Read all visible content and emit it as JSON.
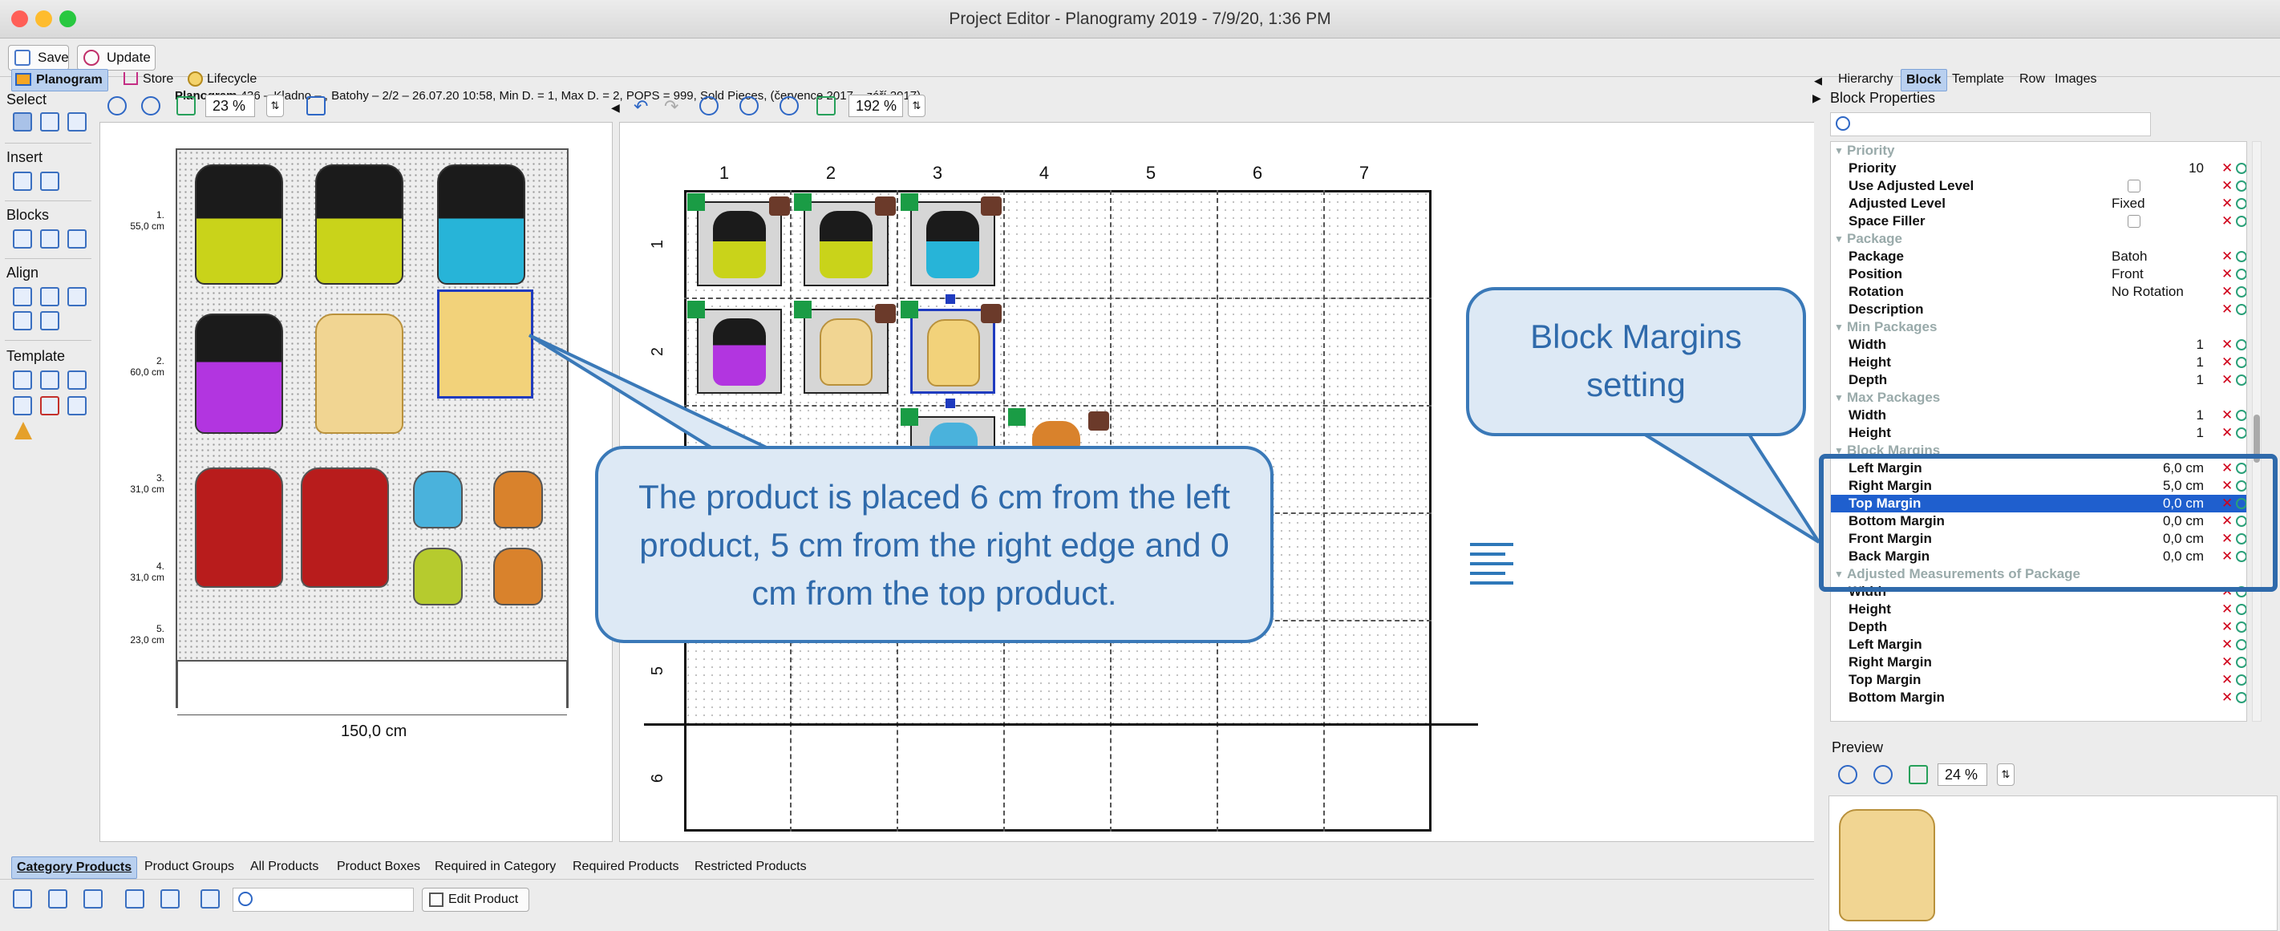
{
  "window": {
    "title": "Project Editor - Planogramy 2019 - 7/9/20, 1:36 PM"
  },
  "toolbar": {
    "save_label": "Save",
    "update_label": "Update",
    "info_bold": "Planogram",
    "info_text": " 436 – Kladno – , Batohy – 2/2 – 26.07.20 10:58, Min D. = 1, Max D. = 2, POPS = 999, Sold Pieces, (července 2017 – září 2017)"
  },
  "left_tabs": [
    "Planogram",
    "Store",
    "Lifecycle"
  ],
  "tool_groups": {
    "select": "Select",
    "insert": "Insert",
    "blocks": "Blocks",
    "align": "Align",
    "template": "Template"
  },
  "left_view": {
    "zoom": "23 %",
    "shelf_labels": [
      {
        "num": "1.",
        "size": "55,0 cm"
      },
      {
        "num": "2.",
        "size": "60,0 cm"
      },
      {
        "num": "3.",
        "size": "31,0 cm"
      },
      {
        "num": "4.",
        "size": "31,0 cm"
      },
      {
        "num": "5.",
        "size": "23,0 cm"
      }
    ],
    "width_label": "150,0 cm"
  },
  "center_view": {
    "zoom": "192 %",
    "columns": [
      "1",
      "2",
      "3",
      "4",
      "5",
      "6",
      "7"
    ],
    "rows": [
      "1",
      "2",
      "5",
      "6"
    ]
  },
  "right_tabs": [
    "Hierarchy",
    "Block",
    "Template",
    "Row",
    "Images"
  ],
  "block_properties": {
    "title": "Block Properties",
    "sections": [
      {
        "name": "Priority",
        "rows": [
          {
            "k": "Priority",
            "v": "10",
            "align": "right"
          },
          {
            "k": "Use Adjusted Level",
            "v": "",
            "check": true
          },
          {
            "k": "Adjusted Level",
            "v": "Fixed"
          },
          {
            "k": "Space Filler",
            "v": "",
            "check": true
          }
        ]
      },
      {
        "name": "Package",
        "rows": [
          {
            "k": "Package",
            "v": "Batoh"
          },
          {
            "k": "Position",
            "v": "Front"
          },
          {
            "k": "Rotation",
            "v": "No Rotation"
          },
          {
            "k": "Description",
            "v": ""
          }
        ]
      },
      {
        "name": "Min Packages",
        "rows": [
          {
            "k": "Width",
            "v": "1",
            "align": "right"
          },
          {
            "k": "Height",
            "v": "1",
            "align": "right"
          },
          {
            "k": "Depth",
            "v": "1",
            "align": "right"
          }
        ]
      },
      {
        "name": "Max Packages",
        "rows": [
          {
            "k": "Width",
            "v": "1",
            "align": "right"
          },
          {
            "k": "Height",
            "v": "1",
            "align": "right"
          }
        ]
      },
      {
        "name": "Block Margins",
        "rows": [
          {
            "k": "Left Margin",
            "v": "6,0 cm",
            "align": "right"
          },
          {
            "k": "Right Margin",
            "v": "5,0 cm",
            "align": "right"
          },
          {
            "k": "Top Margin",
            "v": "0,0 cm",
            "align": "right",
            "selected": true
          },
          {
            "k": "Bottom Margin",
            "v": "0,0 cm",
            "align": "right"
          },
          {
            "k": "Front Margin",
            "v": "0,0 cm",
            "align": "right"
          },
          {
            "k": "Back Margin",
            "v": "0,0 cm",
            "align": "right"
          }
        ]
      },
      {
        "name": "Adjusted Measurements of Package",
        "rows": [
          {
            "k": "Width",
            "v": ""
          },
          {
            "k": "Height",
            "v": ""
          },
          {
            "k": "Depth",
            "v": ""
          },
          {
            "k": "Left Margin",
            "v": ""
          },
          {
            "k": "Right Margin",
            "v": ""
          },
          {
            "k": "Top Margin",
            "v": ""
          },
          {
            "k": "Bottom Margin",
            "v": ""
          }
        ]
      }
    ]
  },
  "preview": {
    "title": "Preview",
    "zoom": "24 %"
  },
  "bottom_tabs": [
    "Category Products",
    "Product Groups",
    "All Products",
    "Product Boxes",
    "Required in Category",
    "Required Products",
    "Restricted Products"
  ],
  "bottom_toolbar": {
    "edit_product": "Edit Product"
  },
  "callouts": {
    "margins_title": "Block Margins setting",
    "product_note": "The product is placed 6 cm from the left product, 5 cm from the right edge and 0 cm from the top product."
  },
  "colors": {
    "callout_border": "#3a79b8",
    "callout_fill": "#dde9f5",
    "selection": "#1f5fce",
    "green_marker": "#1a9c45"
  }
}
